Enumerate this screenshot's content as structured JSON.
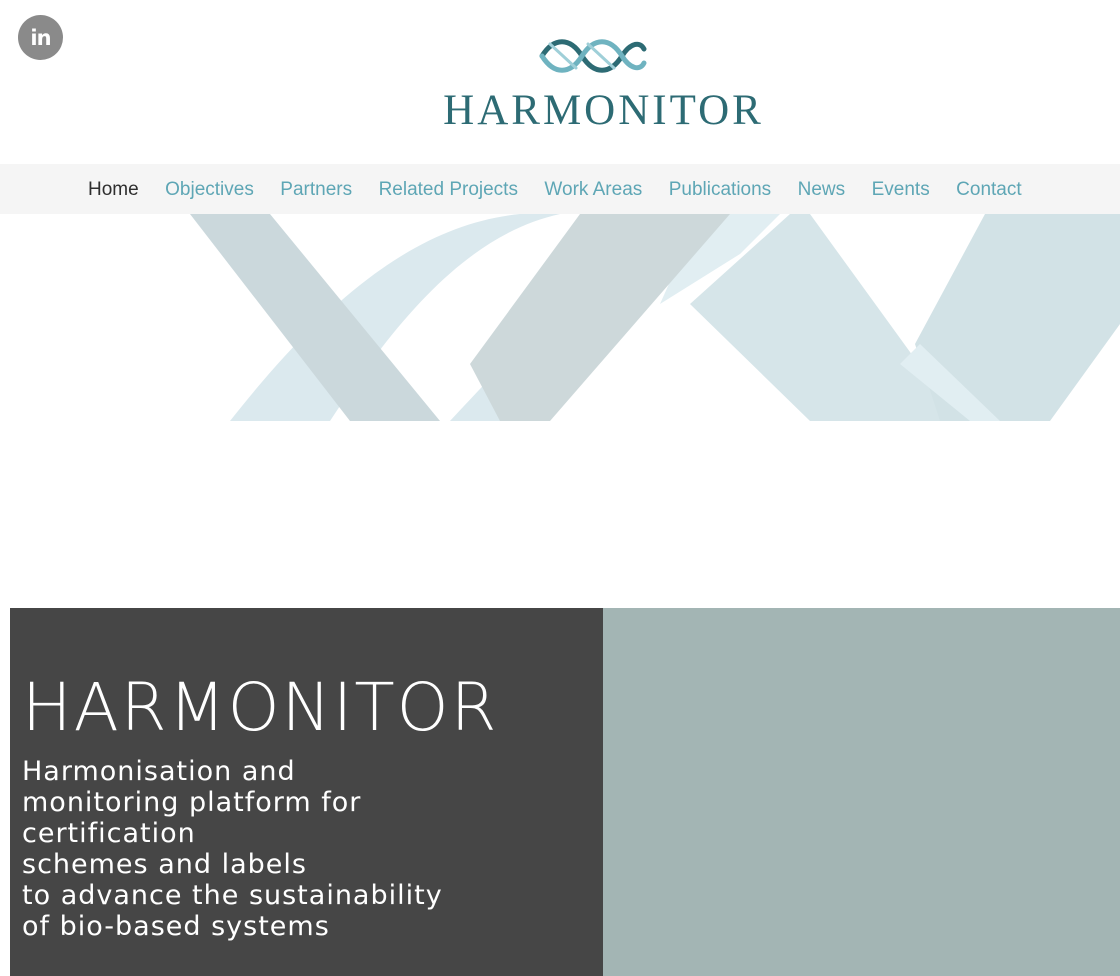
{
  "social": {
    "linkedin_label": "in",
    "icon": "linkedin-icon"
  },
  "brand": {
    "name": "HARMONITOR",
    "logo_icon": "dna-helix-logo-icon",
    "color": "#2d6b74"
  },
  "nav": {
    "items": [
      {
        "label": "Home",
        "active": true
      },
      {
        "label": "Objectives"
      },
      {
        "label": "Partners"
      },
      {
        "label": "Related Projects"
      },
      {
        "label": "Work Areas"
      },
      {
        "label": "Publications"
      },
      {
        "label": "News"
      },
      {
        "label": "Events"
      },
      {
        "label": "Contact"
      }
    ],
    "active_color": "#2e2e2e",
    "link_color": "#5ea6b5"
  },
  "hero": {
    "title": "HARMONITOR",
    "subtitle_lines": [
      "Harmonisation and",
      "monitoring platform for",
      "certification",
      "schemes and labels",
      "to advance the sustainability",
      "of bio-based systems"
    ],
    "left_bg": "#464646",
    "right_bg": "#a3b5b4"
  }
}
